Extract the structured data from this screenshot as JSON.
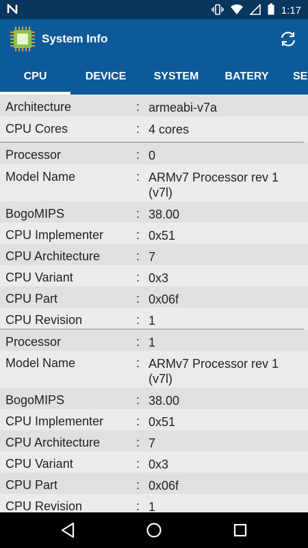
{
  "status": {
    "left_icon": "n-notification-icon",
    "time": "1:17"
  },
  "app": {
    "title": "System Info"
  },
  "tabs": [
    {
      "label": "CPU",
      "active": true
    },
    {
      "label": "DEVICE"
    },
    {
      "label": "SYSTEM"
    },
    {
      "label": "BATERY"
    },
    {
      "label": "SE"
    }
  ],
  "rows": [
    {
      "k": "Architecture",
      "v": "armeabi-v7a"
    },
    {
      "k": "CPU Cores",
      "v": "4 cores",
      "divider": true
    },
    {
      "k": "Processor",
      "v": "0"
    },
    {
      "k": "Model Name",
      "v": "ARMv7 Processor rev 1 (v7l)"
    },
    {
      "k": "BogoMIPS",
      "v": "38.00"
    },
    {
      "k": "CPU Implementer",
      "v": "0x51"
    },
    {
      "k": "CPU Architecture",
      "v": "7"
    },
    {
      "k": "CPU Variant",
      "v": "0x3"
    },
    {
      "k": "CPU Part",
      "v": "0x06f"
    },
    {
      "k": "CPU Revision",
      "v": "1",
      "divider": true
    },
    {
      "k": "Processor",
      "v": "1"
    },
    {
      "k": "Model Name",
      "v": "ARMv7 Processor rev 1 (v7l)"
    },
    {
      "k": "BogoMIPS",
      "v": "38.00"
    },
    {
      "k": "CPU Implementer",
      "v": "0x51"
    },
    {
      "k": "CPU Architecture",
      "v": "7"
    },
    {
      "k": "CPU Variant",
      "v": "0x3"
    },
    {
      "k": "CPU Part",
      "v": "0x06f"
    },
    {
      "k": "CPU Revision",
      "v": "1"
    }
  ],
  "separator": ":",
  "colors": {
    "status_bar": "#08365c",
    "app_bar": "#0d5a9a",
    "list_bg": "#e0e0e0",
    "text": "#222222"
  }
}
